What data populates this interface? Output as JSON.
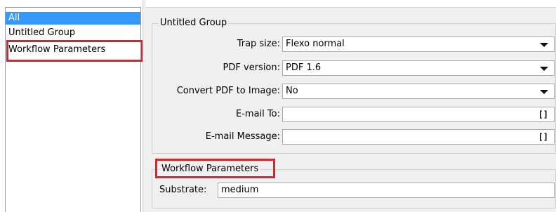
{
  "sidebar": {
    "items": [
      {
        "label": "All",
        "selected": true
      },
      {
        "label": "Untitled Group",
        "selected": false
      },
      {
        "label": "Workflow Parameters",
        "selected": false
      }
    ]
  },
  "main": {
    "group1": {
      "title": "Untitled Group",
      "fields": [
        {
          "label": "Trap size:",
          "value": "Flexo normal",
          "type": "dropdown"
        },
        {
          "label": "PDF version:",
          "value": "PDF 1.6",
          "type": "dropdown"
        },
        {
          "label": "Convert PDF to Image:",
          "value": "No",
          "type": "dropdown"
        },
        {
          "label": "E-mail To:",
          "value": "",
          "type": "text",
          "icon": "[]"
        },
        {
          "label": "E-mail Message:",
          "value": "",
          "type": "text",
          "icon": "[]"
        }
      ]
    },
    "group2": {
      "title": "Workflow Parameters",
      "fields": [
        {
          "label": "Substrate:",
          "value": "medium",
          "type": "text"
        }
      ]
    }
  },
  "colors": {
    "selection": "#3399ff",
    "highlight_box": "#e0202a",
    "panel_background": "#f0f0f0"
  }
}
